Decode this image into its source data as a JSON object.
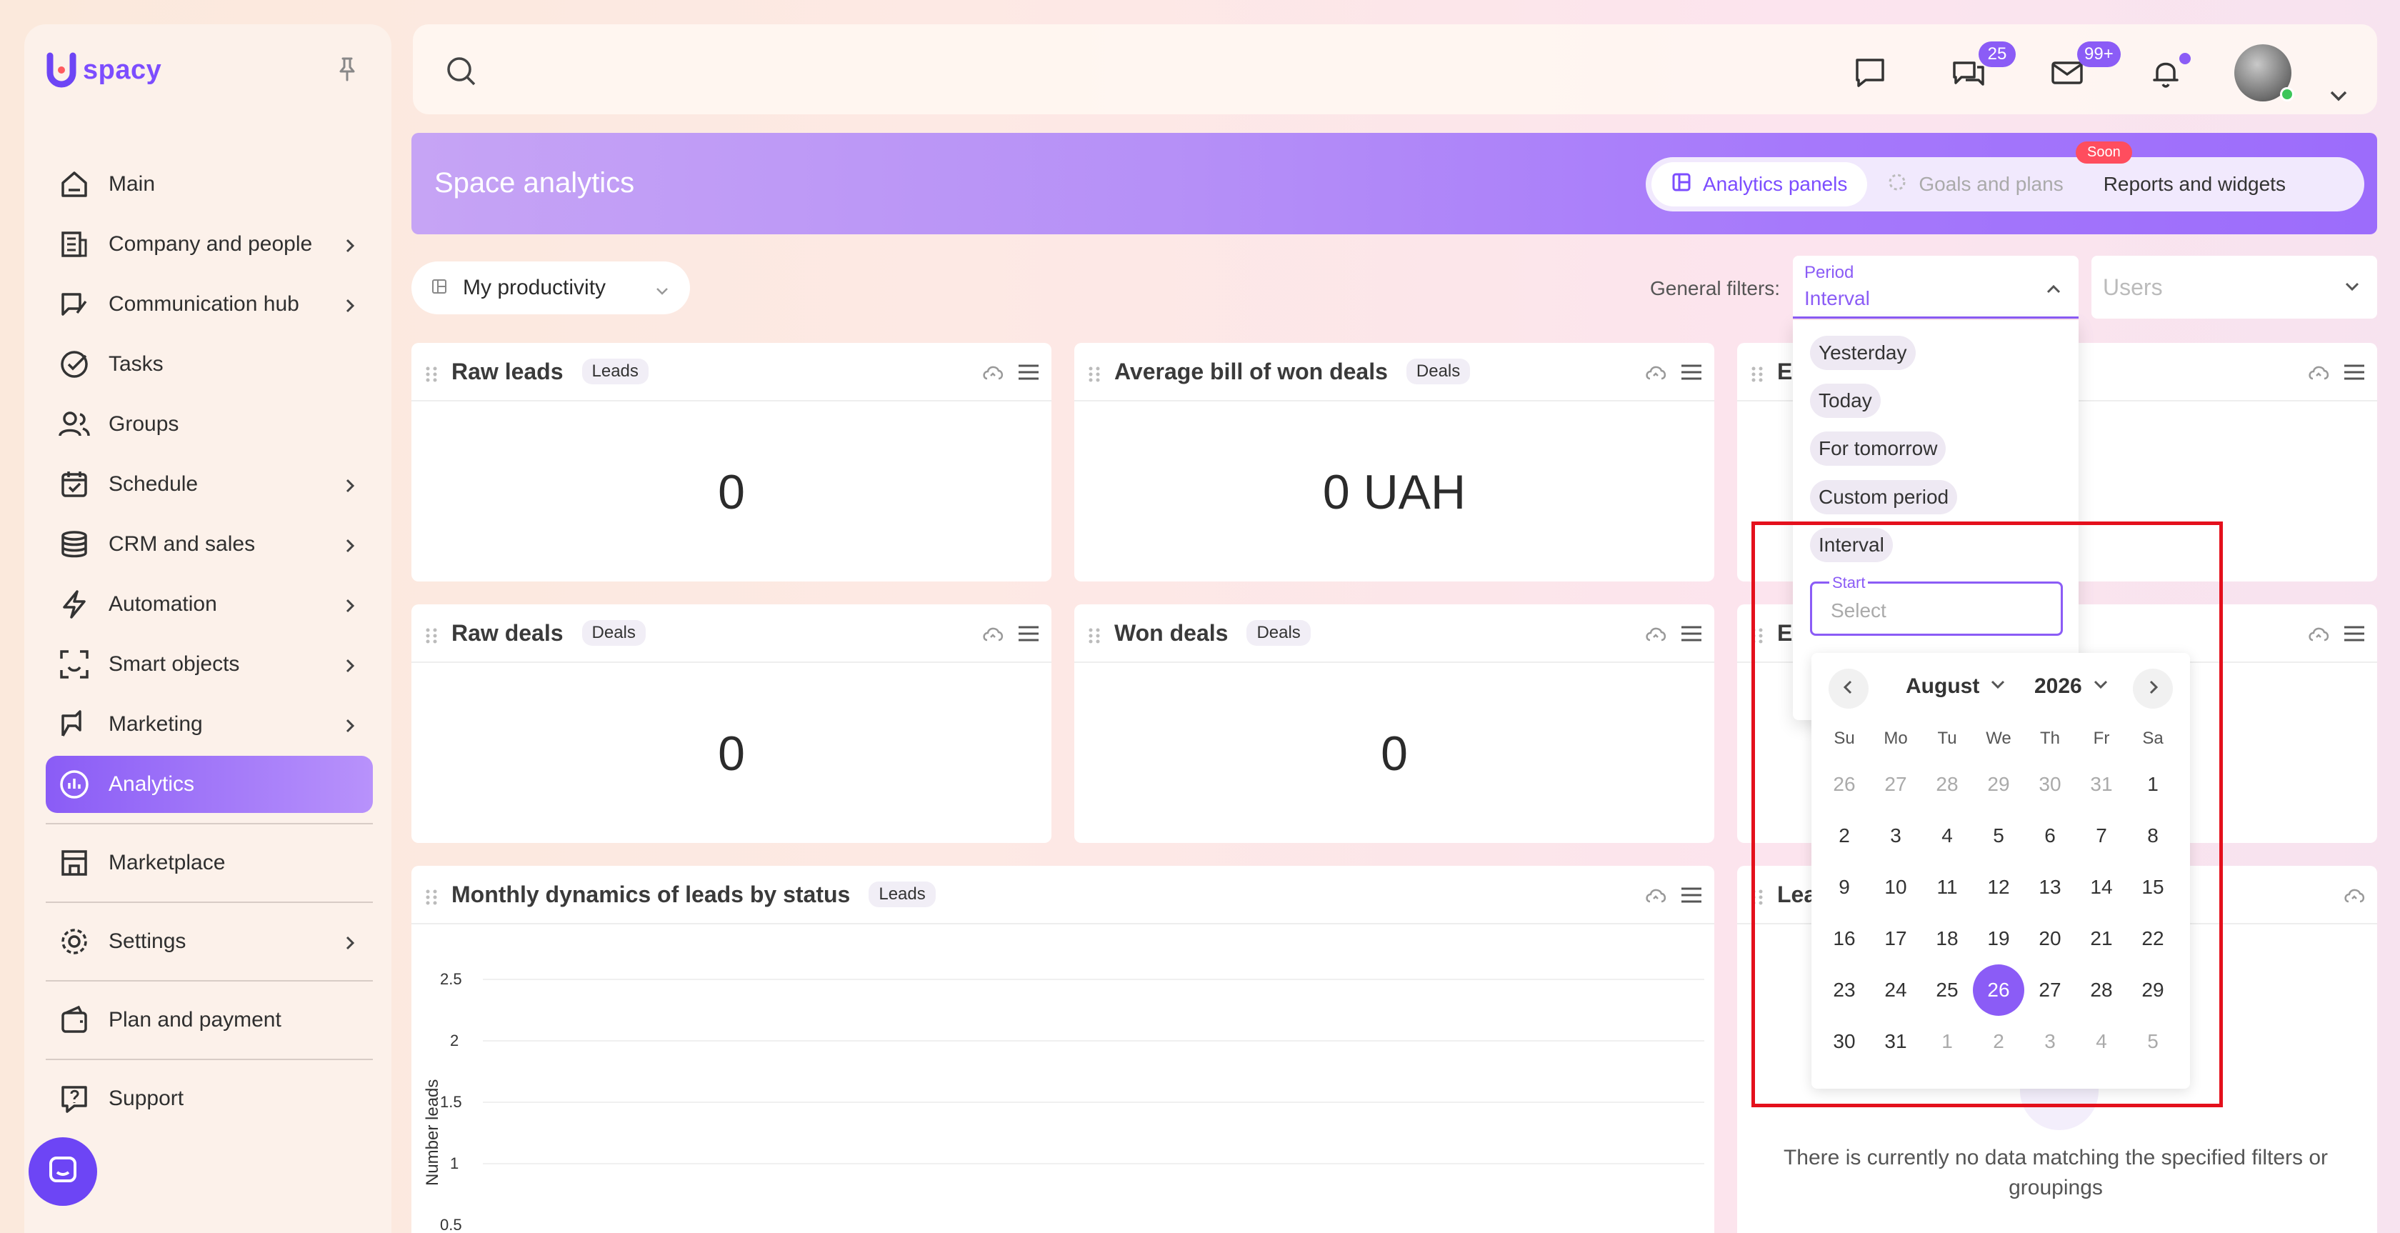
{
  "app": {
    "logo_text": "spacy"
  },
  "sidebar": {
    "items": [
      {
        "label": "Main",
        "icon": "home-icon",
        "chevron": false
      },
      {
        "label": "Company and people",
        "icon": "building-icon",
        "chevron": true
      },
      {
        "label": "Communication hub",
        "icon": "chat-edit-icon",
        "chevron": true
      },
      {
        "label": "Tasks",
        "icon": "check-circle-icon",
        "chevron": false
      },
      {
        "label": "Groups",
        "icon": "users-icon",
        "chevron": false
      },
      {
        "label": "Schedule",
        "icon": "calendar-check-icon",
        "chevron": true
      },
      {
        "label": "CRM and sales",
        "icon": "coins-icon",
        "chevron": true
      },
      {
        "label": "Automation",
        "icon": "lightning-icon",
        "chevron": true
      },
      {
        "label": "Smart objects",
        "icon": "scan-face-icon",
        "chevron": true
      },
      {
        "label": "Marketing",
        "icon": "megaphone-icon",
        "chevron": true
      },
      {
        "label": "Analytics",
        "icon": "chart-pie-icon",
        "chevron": false,
        "active": true
      }
    ],
    "marketplace": "Marketplace",
    "settings": "Settings",
    "plan": "Plan and payment",
    "support": "Support"
  },
  "topbar": {
    "chat_badge": "25",
    "mail_badge": "99+"
  },
  "header": {
    "title": "Space analytics",
    "tabs": [
      {
        "label": "Analytics panels",
        "active": true
      },
      {
        "label": "Goals and plans",
        "disabled": true
      },
      {
        "label": "Reports and widgets"
      }
    ],
    "soon_badge": "Soon"
  },
  "filters": {
    "dashboard": "My productivity",
    "general_label": "General filters:",
    "period_label": "Period",
    "period_value": "Interval",
    "users_placeholder": "Users"
  },
  "widgets": [
    {
      "title": "Raw leads",
      "tag": "Leads",
      "value": "0"
    },
    {
      "title": "Average bill of won deals",
      "tag": "Deals",
      "value": "0 UAH"
    },
    {
      "title": "Ex"
    },
    {
      "title": "Raw deals",
      "tag": "Deals",
      "value": "0"
    },
    {
      "title": "Won deals",
      "tag": "Deals",
      "value": "0"
    },
    {
      "title": "Ex"
    },
    {
      "title": "Monthly dynamics of leads by status",
      "tag": "Leads"
    },
    {
      "title": "Lea"
    }
  ],
  "chart": {
    "ylabel": "Number leads",
    "ticks": [
      "2.5",
      "2",
      "1.5",
      "1",
      "0.5"
    ]
  },
  "nodata": "There is currently no data matching the specified filters or groupings",
  "period_options": [
    "Yesterday",
    "Today",
    "For tomorrow",
    "Custom period",
    "Interval"
  ],
  "start_field": {
    "label": "Start",
    "placeholder": "Select"
  },
  "calendar": {
    "month": "August",
    "year": "2026",
    "weekdays": [
      "Su",
      "Mo",
      "Tu",
      "We",
      "Th",
      "Fr",
      "Sa"
    ],
    "weeks": [
      [
        "26",
        "27",
        "28",
        "29",
        "30",
        "31",
        "1"
      ],
      [
        "2",
        "3",
        "4",
        "5",
        "6",
        "7",
        "8"
      ],
      [
        "9",
        "10",
        "11",
        "12",
        "13",
        "14",
        "15"
      ],
      [
        "16",
        "17",
        "18",
        "19",
        "20",
        "21",
        "22"
      ],
      [
        "23",
        "24",
        "25",
        "26",
        "27",
        "28",
        "29"
      ],
      [
        "30",
        "31",
        "1",
        "2",
        "3",
        "4",
        "5"
      ]
    ],
    "selected": "26",
    "colors": {
      "accent": "#8b5cf6",
      "highlight_box": "#e4101c"
    }
  }
}
